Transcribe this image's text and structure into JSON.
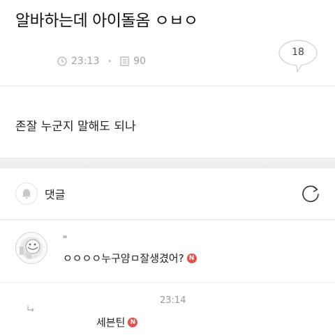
{
  "post": {
    "title": "알바하는데 아이돌옴 ㅇㅂㅇ",
    "time": "23:13",
    "views": "90",
    "comment_count": "18",
    "body": "존잘 누군지 말해도 되나"
  },
  "comments_section": {
    "label": "댓글"
  },
  "comments": [
    {
      "text": "ㅇㅇㅇㅇ누구얌ㅁ잘생겼어?",
      "new_badge": "N"
    }
  ],
  "reply": {
    "author": "",
    "time": "23:14",
    "text": "세븐틴",
    "new_badge": "N"
  },
  "icons": [
    "clock-icon",
    "document-icon",
    "speech-bubble-icon",
    "bell-icon",
    "refresh-icon",
    "reply-arrow-icon"
  ],
  "colors": {
    "new_badge": "#e8504a",
    "meta_text": "#a0a0a0",
    "section_gap": "#efefef"
  }
}
